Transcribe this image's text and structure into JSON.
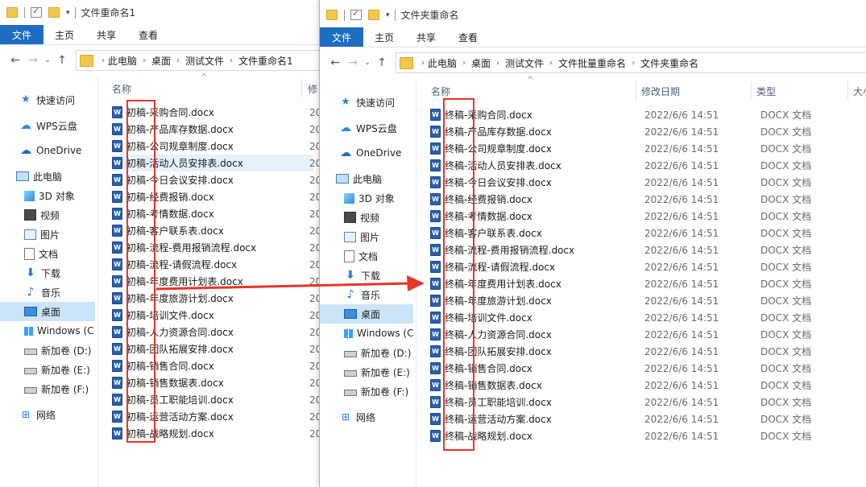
{
  "left_window": {
    "title": "文件重命名1",
    "ribbon_tabs": [
      "文件",
      "主页",
      "共享",
      "查看"
    ],
    "breadcrumb": [
      "此电脑",
      "桌面",
      "测试文件",
      "文件重命名1"
    ],
    "column_name": "名称",
    "column_date_partial": "修",
    "date_partial": "20",
    "files": [
      "初稿-采购合同.docx",
      "初稿-产品库存数据.docx",
      "初稿-公司规章制度.docx",
      "初稿-活动人员安排表.docx",
      "初稿-今日会议安排.docx",
      "初稿-经费报销.docx",
      "初稿-考情数据.docx",
      "初稿-客户联系表.docx",
      "初稿-流程-费用报销流程.docx",
      "初稿-流程-请假流程.docx",
      "初稿-年度费用计划表.docx",
      "初稿-年度旅游计划.docx",
      "初稿-培训文件.docx",
      "初稿-人力资源合同.docx",
      "初稿-团队拓展安排.docx",
      "初稿-销售合同.docx",
      "初稿-销售数据表.docx",
      "初稿-员工职能培训.docx",
      "初稿-运营活动方案.docx",
      "初稿-战略规划.docx"
    ]
  },
  "right_window": {
    "title": "文件夹重命名",
    "ribbon_tabs": [
      "文件",
      "主页",
      "共享",
      "查看"
    ],
    "breadcrumb": [
      "此电脑",
      "桌面",
      "测试文件",
      "文件批量重命名",
      "文件夹重命名"
    ],
    "column_name": "名称",
    "column_date": "修改日期",
    "column_type": "类型",
    "column_size_partial": "大小",
    "file_date": "2022/6/6 14:51",
    "file_type": "DOCX 文档",
    "files": [
      "终稿-采购合同.docx",
      "终稿-产品库存数据.docx",
      "终稿-公司规章制度.docx",
      "终稿-活动人员安排表.docx",
      "终稿-今日会议安排.docx",
      "终稿-经费报销.docx",
      "终稿-考情数据.docx",
      "终稿-客户联系表.docx",
      "终稿-流程-费用报销流程.docx",
      "终稿-流程-请假流程.docx",
      "终稿-年度费用计划表.docx",
      "终稿-年度旅游计划.docx",
      "终稿-培训文件.docx",
      "终稿-人力资源合同.docx",
      "终稿-团队拓展安排.docx",
      "终稿-销售合同.docx",
      "终稿-销售数据表.docx",
      "终稿-员工职能培训.docx",
      "终稿-运营活动方案.docx",
      "终稿-战略规划.docx"
    ]
  },
  "sidebar": [
    {
      "label": "快速访问",
      "icon": "quick-access-star-icon"
    },
    {
      "label": "WPS云盘",
      "icon": "wps-cloud-icon"
    },
    {
      "label": "OneDrive",
      "icon": "onedrive-cloud-icon"
    },
    {
      "label": "此电脑",
      "icon": "this-pc-icon"
    },
    {
      "label": "3D 对象",
      "icon": "3d-objects-icon"
    },
    {
      "label": "视频",
      "icon": "video-icon"
    },
    {
      "label": "图片",
      "icon": "pictures-icon"
    },
    {
      "label": "文档",
      "icon": "documents-icon"
    },
    {
      "label": "下载",
      "icon": "downloads-icon"
    },
    {
      "label": "音乐",
      "icon": "music-icon"
    },
    {
      "label": "桌面",
      "icon": "desktop-icon"
    },
    {
      "label": "Windows (C",
      "icon": "windows-drive-icon"
    },
    {
      "label": "新加卷 (D:)",
      "icon": "drive-d-icon"
    },
    {
      "label": "新加卷 (E:)",
      "icon": "drive-e-icon"
    },
    {
      "label": "新加卷 (F:)",
      "icon": "drive-f-icon"
    },
    {
      "label": "网络",
      "icon": "network-icon"
    }
  ],
  "colors": {
    "file_tab_blue": "#1e6dc0",
    "selected_bg": "#cce4f7",
    "annotation_red": "#e8342a",
    "word_icon_blue": "#2b5faf"
  }
}
